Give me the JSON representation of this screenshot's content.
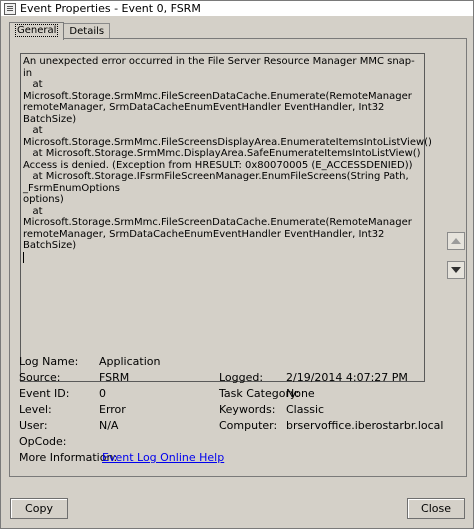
{
  "window": {
    "title": "Event Properties - Event 0, FSRM"
  },
  "tabs": [
    {
      "label": "General"
    },
    {
      "label": "Details"
    }
  ],
  "message": {
    "text": "An unexpected error occurred in the File Server Resource Manager MMC snap-in\n   at Microsoft.Storage.SrmMmc.FileScreenDataCache.Enumerate(RemoteManager\nremoteManager, SrmDataCacheEnumEventHandler EventHandler, Int32 BatchSize)\n   at Microsoft.Storage.SrmMmc.FileScreensDisplayArea.EnumerateItemsIntoListView()\n   at Microsoft.Storage.SrmMmc.DisplayArea.SafeEnumerateItemsIntoListView()\nAccess is denied. (Exception from HRESULT: 0x80070005 (E_ACCESSDENIED))\n   at Microsoft.Storage.IFsrmFileScreenManager.EnumFileScreens(String Path, _FsrmEnumOptions\noptions)\n   at Microsoft.Storage.SrmMmc.FileScreenDataCache.Enumerate(RemoteManager\nremoteManager, SrmDataCacheEnumEventHandler EventHandler, Int32 BatchSize)"
  },
  "fields": {
    "log_name_label": "Log Name:",
    "log_name_value": "Application",
    "source_label": "Source:",
    "source_value": "FSRM",
    "event_id_label": "Event ID:",
    "event_id_value": "0",
    "level_label": "Level:",
    "level_value": "Error",
    "user_label": "User:",
    "user_value": "N/A",
    "opcode_label": "OpCode:",
    "opcode_value": "",
    "more_info_label": "More Information:",
    "more_info_link": "Event Log Online Help",
    "logged_label": "Logged:",
    "logged_value": "2/19/2014 4:07:27 PM",
    "task_category_label": "Task Category:",
    "task_category_value": "None",
    "keywords_label": "Keywords:",
    "keywords_value": "Classic",
    "computer_label": "Computer:",
    "computer_value": "brservoffice.iberostarbr.local"
  },
  "buttons": {
    "copy": "Copy",
    "close": "Close"
  },
  "colors": {
    "link": "#0000ee",
    "background": "#d4d0c8"
  }
}
